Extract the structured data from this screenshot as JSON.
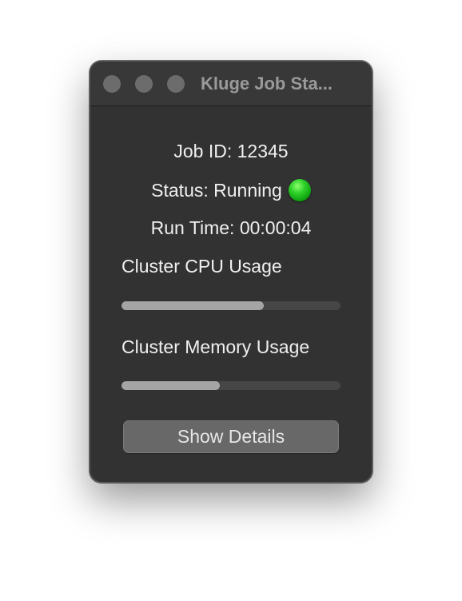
{
  "window": {
    "title": "Kluge Job Sta..."
  },
  "job": {
    "id_text": "Job ID: 12345",
    "status_text": "Status: Running",
    "status_indicator": "green-circle-icon",
    "status_color": "#1ec41e",
    "runtime_text": "Run Time: 00:00:04"
  },
  "cpu": {
    "label": "Cluster CPU Usage",
    "usage_fraction": 0.65
  },
  "memory": {
    "label": "Cluster Memory Usage",
    "usage_fraction": 0.45
  },
  "actions": {
    "details_label": "Show Details"
  }
}
